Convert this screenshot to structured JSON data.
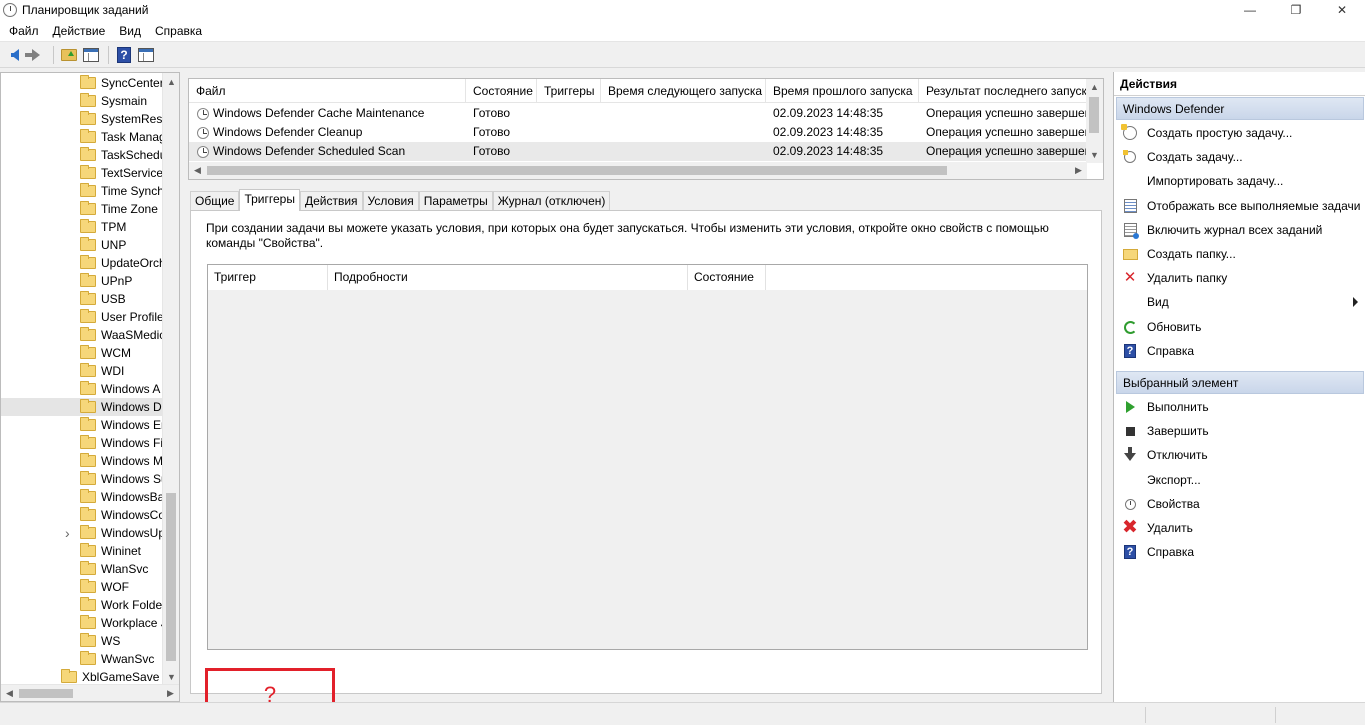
{
  "window": {
    "title": "Планировщик заданий",
    "minimize": "—",
    "maximize": "❐",
    "close": "✕"
  },
  "menu": [
    "Файл",
    "Действие",
    "Вид",
    "Справка"
  ],
  "toolbar": {
    "help_glyph": "?"
  },
  "tree": {
    "items": [
      {
        "label": "SyncCenter",
        "selected": false,
        "expandable": false
      },
      {
        "label": "Sysmain",
        "selected": false,
        "expandable": false
      },
      {
        "label": "SystemRest",
        "selected": false,
        "expandable": false
      },
      {
        "label": "Task Manag",
        "selected": false,
        "expandable": false
      },
      {
        "label": "TaskSchedu",
        "selected": false,
        "expandable": false
      },
      {
        "label": "TextServices",
        "selected": false,
        "expandable": false
      },
      {
        "label": "Time Synch",
        "selected": false,
        "expandable": false
      },
      {
        "label": "Time Zone",
        "selected": false,
        "expandable": false
      },
      {
        "label": "TPM",
        "selected": false,
        "expandable": false
      },
      {
        "label": "UNP",
        "selected": false,
        "expandable": false
      },
      {
        "label": "UpdateOrch",
        "selected": false,
        "expandable": false
      },
      {
        "label": "UPnP",
        "selected": false,
        "expandable": false
      },
      {
        "label": "USB",
        "selected": false,
        "expandable": false
      },
      {
        "label": "User Profile",
        "selected": false,
        "expandable": false
      },
      {
        "label": "WaaSMedic",
        "selected": false,
        "expandable": false
      },
      {
        "label": "WCM",
        "selected": false,
        "expandable": false
      },
      {
        "label": "WDI",
        "selected": false,
        "expandable": false
      },
      {
        "label": "Windows A",
        "selected": false,
        "expandable": false
      },
      {
        "label": "Windows D",
        "selected": true,
        "expandable": false
      },
      {
        "label": "Windows Er",
        "selected": false,
        "expandable": false
      },
      {
        "label": "Windows Fi",
        "selected": false,
        "expandable": false
      },
      {
        "label": "Windows M",
        "selected": false,
        "expandable": false
      },
      {
        "label": "Windows Su",
        "selected": false,
        "expandable": false
      },
      {
        "label": "WindowsBa",
        "selected": false,
        "expandable": false
      },
      {
        "label": "WindowsCo",
        "selected": false,
        "expandable": false
      },
      {
        "label": "WindowsUp",
        "selected": false,
        "expandable": true
      },
      {
        "label": "Wininet",
        "selected": false,
        "expandable": false
      },
      {
        "label": "WlanSvc",
        "selected": false,
        "expandable": false
      },
      {
        "label": "WOF",
        "selected": false,
        "expandable": false
      },
      {
        "label": "Work Folde",
        "selected": false,
        "expandable": false
      },
      {
        "label": "Workplace J",
        "selected": false,
        "expandable": false
      },
      {
        "label": "WS",
        "selected": false,
        "expandable": false
      },
      {
        "label": "WwanSvc",
        "selected": false,
        "expandable": false
      },
      {
        "label": "XblGameSave",
        "selected": false,
        "expandable": false,
        "top_level": true
      }
    ]
  },
  "task_list": {
    "columns": [
      "Файл",
      "Состояние",
      "Триггеры",
      "Время следующего запуска",
      "Время прошлого запуска",
      "Результат последнего запуска"
    ],
    "rows": [
      {
        "name": "Windows Defender Cache Maintenance",
        "state": "Готово",
        "triggers": "",
        "next_run": "",
        "last_run": "02.09.2023 14:48:35",
        "last_result": "Операция успешно завершена.",
        "selected": false
      },
      {
        "name": "Windows Defender Cleanup",
        "state": "Готово",
        "triggers": "",
        "next_run": "",
        "last_run": "02.09.2023 14:48:35",
        "last_result": "Операция успешно завершена.",
        "selected": false
      },
      {
        "name": "Windows Defender Scheduled Scan",
        "state": "Готово",
        "triggers": "",
        "next_run": "",
        "last_run": "02.09.2023 14:48:35",
        "last_result": "Операция успешно завершена.",
        "selected": true
      }
    ]
  },
  "details": {
    "tabs": [
      {
        "label": "Общие",
        "active": false
      },
      {
        "label": "Триггеры",
        "active": true
      },
      {
        "label": "Действия",
        "active": false
      },
      {
        "label": "Условия",
        "active": false
      },
      {
        "label": "Параметры",
        "active": false
      },
      {
        "label": "Журнал (отключен)",
        "active": false
      }
    ],
    "triggers_description": "При создании задачи вы можете указать условия, при которых она будет запускаться.  Чтобы изменить эти условия, откройте окно свойств с помощью команды \"Свойства\".",
    "triggers_columns": [
      "Триггер",
      "Подробности",
      "Состояние"
    ],
    "annotation_mark": "?"
  },
  "actions": {
    "title": "Действия",
    "sections": [
      {
        "header": "Windows Defender",
        "items": [
          {
            "label": "Создать простую задачу...",
            "icon": "create-basic-task-icon",
            "submenu": false
          },
          {
            "label": "Создать задачу...",
            "icon": "create-task-icon",
            "submenu": false
          },
          {
            "label": "Импортировать задачу...",
            "icon": "",
            "submenu": false
          },
          {
            "label": "Отображать все выполняемые задачи",
            "icon": "running-tasks-icon",
            "submenu": false
          },
          {
            "label": "Включить журнал всех заданий",
            "icon": "enable-history-icon",
            "submenu": false
          },
          {
            "label": "Создать папку...",
            "icon": "new-folder-icon",
            "submenu": false
          },
          {
            "label": "Удалить папку",
            "icon": "delete-folder-icon",
            "submenu": false
          },
          {
            "label": "Вид",
            "icon": "",
            "submenu": true
          },
          {
            "label": "Обновить",
            "icon": "refresh-icon",
            "submenu": false
          },
          {
            "label": "Справка",
            "icon": "help-icon",
            "submenu": false
          }
        ]
      },
      {
        "header": "Выбранный элемент",
        "items": [
          {
            "label": "Выполнить",
            "icon": "run-icon",
            "submenu": false
          },
          {
            "label": "Завершить",
            "icon": "stop-icon",
            "submenu": false
          },
          {
            "label": "Отключить",
            "icon": "disable-icon",
            "submenu": false
          },
          {
            "label": "Экспорт...",
            "icon": "",
            "submenu": false
          },
          {
            "label": "Свойства",
            "icon": "properties-icon",
            "submenu": false
          },
          {
            "label": "Удалить",
            "icon": "delete-icon",
            "submenu": false
          },
          {
            "label": "Справка",
            "icon": "help-icon",
            "submenu": false
          }
        ]
      }
    ]
  },
  "colors": {
    "annotation_red": "#e2202a",
    "section_header": "#c9d6ea"
  }
}
